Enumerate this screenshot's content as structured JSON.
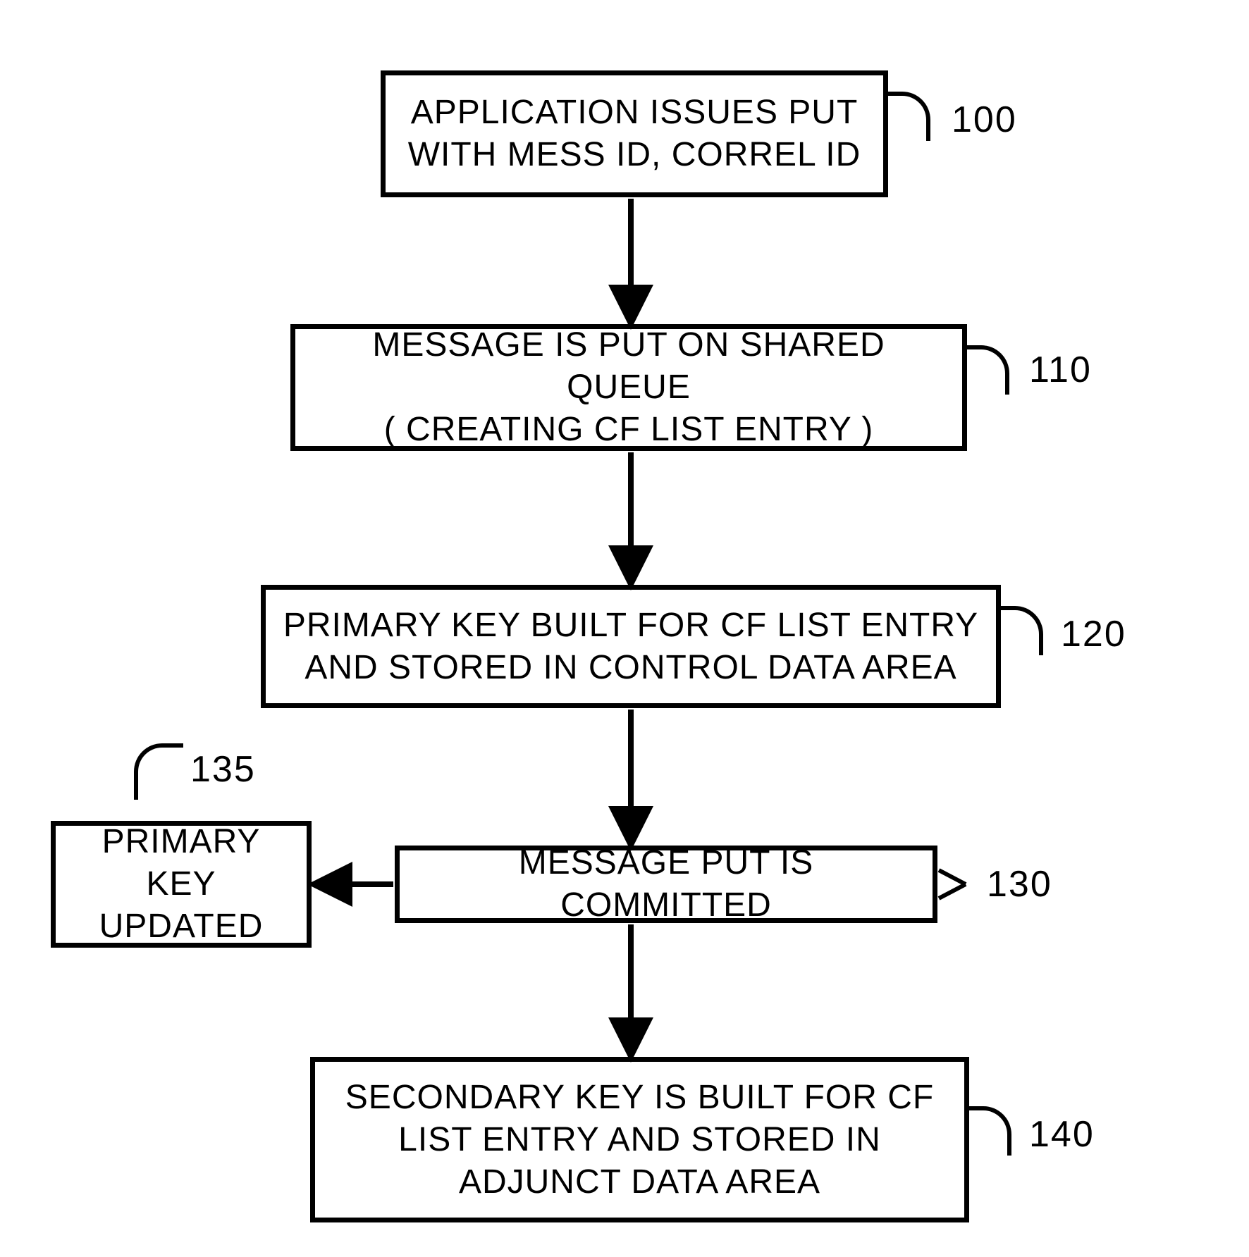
{
  "boxes": {
    "b100": {
      "text": "APPLICATION ISSUES PUT\nWITH  MESS ID, CORREL ID",
      "ref": "100"
    },
    "b110": {
      "text": "MESSAGE IS PUT ON  SHARED QUEUE\n( CREATING CF LIST ENTRY )",
      "ref": "110"
    },
    "b120": {
      "text": "PRIMARY KEY BUILT FOR CF LIST ENTRY\nAND STORED IN CONTROL DATA AREA",
      "ref": "120"
    },
    "b130": {
      "text": "MESSAGE PUT IS COMMITTED",
      "ref": "130"
    },
    "b135": {
      "text": "PRIMARY KEY\nUPDATED",
      "ref": "135"
    },
    "b140": {
      "text": "SECONDARY KEY IS BUILT FOR CF\nLIST ENTRY AND STORED IN\nADJUNCT DATA AREA",
      "ref": "140"
    }
  }
}
